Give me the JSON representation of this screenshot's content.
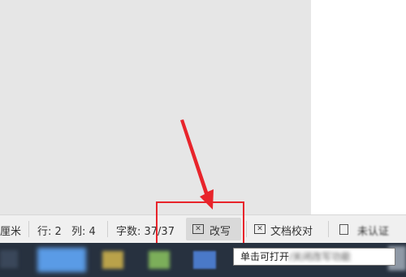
{
  "statusbar": {
    "unit_label": "厘米",
    "line_label": "行: 2",
    "col_label": "列: 4",
    "word_count_label": "字数: 37/37",
    "revision_button_label": "改写",
    "proofread_label": "文档校对",
    "cert_label": "未认证"
  },
  "tooltip": {
    "text_visible": "单击可打开",
    "text_blurred": "/关闭改写功能"
  },
  "colors": {
    "highlight": "#e8242b",
    "arrow": "#e8242b",
    "taskbar": "#27313f"
  }
}
